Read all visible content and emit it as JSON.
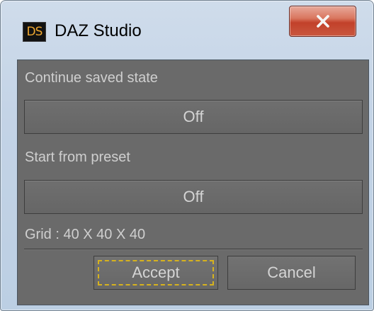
{
  "window": {
    "title": "DAZ Studio",
    "app_icon_text": "DS",
    "close_symbol": "close-icon"
  },
  "dialog": {
    "continue_label": "Continue saved state",
    "continue_value": "Off",
    "preset_label": "Start from preset",
    "preset_value": "Off",
    "grid_info": "Grid : 40 X 40 X 40",
    "accept_label": "Accept",
    "cancel_label": "Cancel"
  },
  "colors": {
    "panel_bg": "#6a6a6a",
    "text": "#d4d4d4",
    "focus_ring": "#d6b21e",
    "close_button": "#c9573f"
  }
}
